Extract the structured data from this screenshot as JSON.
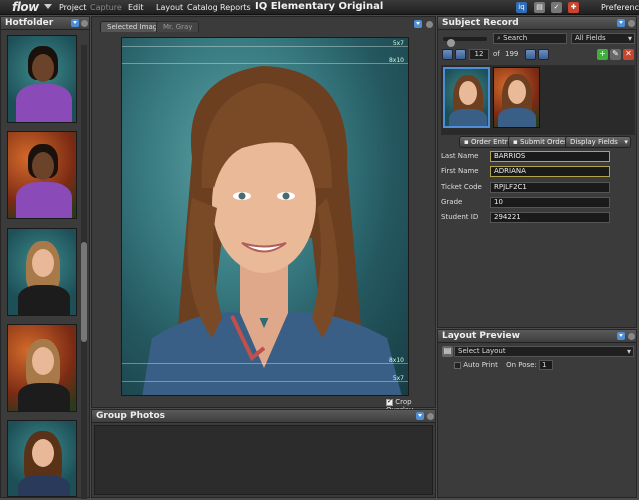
{
  "menubar": {
    "logo": "flow",
    "items": [
      {
        "label": "Project",
        "enabled": true
      },
      {
        "label": "Capture",
        "enabled": false
      },
      {
        "label": "Edit",
        "enabled": true
      },
      {
        "label": "Layout",
        "enabled": true
      },
      {
        "label": "Catalog",
        "enabled": true
      },
      {
        "label": "Reports",
        "enabled": true
      }
    ],
    "app_title": "IQ Elementary Original",
    "preferences": "Preferences"
  },
  "hotfolder": {
    "title": "Hotfolder"
  },
  "center": {
    "tabs": [
      "Selected Image",
      "Mr. Gray"
    ],
    "overlay_labels": [
      "5x7",
      "8x10",
      "8x10",
      "5x7"
    ],
    "crop_overlay_label": "Crop Overlay",
    "crop_overlay_checked": true
  },
  "group_photos": {
    "title": "Group Photos"
  },
  "subject_record": {
    "title": "Subject Record",
    "search_label": "Search",
    "search_scope": "All Fields",
    "current_index": "12",
    "of_label": "of",
    "total": "199",
    "buttons": {
      "order_entry": "Order Entry",
      "submit_orders": "Submit Orders",
      "display_fields": "Display Fields"
    },
    "fields": [
      {
        "label": "Last Name",
        "value": "BARRIOS",
        "highlight": true
      },
      {
        "label": "First Name",
        "value": "ADRIANA",
        "highlight": true
      },
      {
        "label": "Ticket Code",
        "value": "RPJLF2C1",
        "highlight": false
      },
      {
        "label": "Grade",
        "value": "10",
        "highlight": false
      },
      {
        "label": "Student ID",
        "value": "294221",
        "highlight": false
      }
    ]
  },
  "layout_preview": {
    "title": "Layout Preview",
    "select_layout": "Select Layout",
    "auto_print_label": "Auto Print",
    "auto_print_checked": false,
    "on_pose_label": "On Pose:",
    "on_pose_value": "1"
  },
  "colors": {
    "accent_blue": "#4d8fd6",
    "add_green": "#3fae3f",
    "delete_red": "#c8452e",
    "highlight_border": "#b3a24a"
  }
}
